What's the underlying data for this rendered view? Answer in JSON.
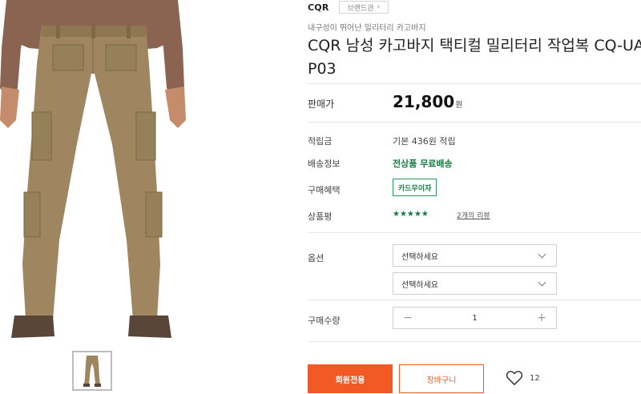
{
  "product": {
    "brand": "CQR",
    "brand_link_label": "브랜드관",
    "brand_link_arrow": "›",
    "subtitle": "내구성이 뛰어난 밀리터리 카고바지",
    "title": "CQR 남성 카고바지 택티컬 밀리터리 작업복 CQ-UAP03"
  },
  "price": {
    "label": "판매가",
    "amount": "21,800",
    "unit": "원"
  },
  "details": {
    "points_label": "적립금",
    "points_value": "기본 436원 적립",
    "shipping_label": "배송정보",
    "shipping_value": "전상품 무료배송",
    "benefit_label": "구매혜택",
    "benefit_badge": "카드무이자",
    "rating_label": "상품평",
    "stars": "★★★★★",
    "rating_value": 5,
    "reviews_link": "2개의 리뷰"
  },
  "options": {
    "label": "옵션",
    "select1_value": "선택하세요",
    "select2_value": "선택하세요"
  },
  "quantity": {
    "label": "구매수량",
    "minus": "−",
    "value": "1",
    "plus": "+"
  },
  "actions": {
    "buy_label": "회원전용",
    "cart_label": "장바구니",
    "like_count": "12"
  },
  "colors": {
    "accent_orange": "#f15a24",
    "accent_green": "#1a7a43",
    "pants_khaki": "#a08660"
  },
  "icons": [
    "chevron-down-icon",
    "heart-icon",
    "star-icon"
  ]
}
